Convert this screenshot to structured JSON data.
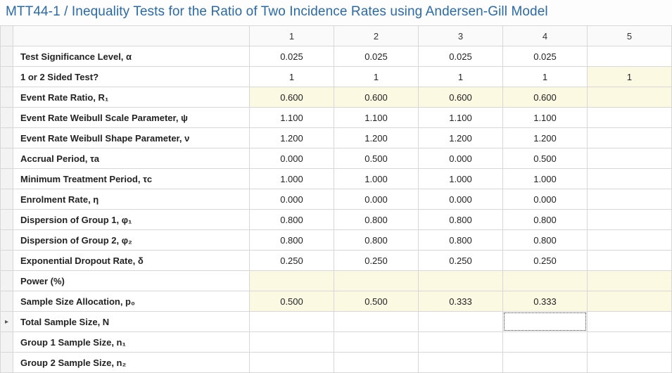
{
  "title": "MTT44-1 / Inequality Tests for the Ratio of Two Incidence Rates using Andersen-Gill Model",
  "columns": [
    "1",
    "2",
    "3",
    "4",
    "5"
  ],
  "rows": [
    {
      "label": "Test Significance Level, α",
      "values": [
        "0.025",
        "0.025",
        "0.025",
        "0.025",
        ""
      ],
      "hl": [
        false,
        false,
        false,
        false,
        false
      ]
    },
    {
      "label": "1 or 2 Sided Test?",
      "values": [
        "1",
        "1",
        "1",
        "1",
        "1"
      ],
      "hl": [
        false,
        false,
        false,
        false,
        true
      ]
    },
    {
      "label": "Event Rate Ratio, R₁",
      "values": [
        "0.600",
        "0.600",
        "0.600",
        "0.600",
        ""
      ],
      "hl": [
        true,
        true,
        true,
        true,
        true
      ]
    },
    {
      "label": "Event Rate Weibull Scale Parameter, ψ",
      "values": [
        "1.100",
        "1.100",
        "1.100",
        "1.100",
        ""
      ],
      "hl": [
        false,
        false,
        false,
        false,
        false
      ]
    },
    {
      "label": "Event Rate Weibull Shape Parameter, ν",
      "values": [
        "1.200",
        "1.200",
        "1.200",
        "1.200",
        ""
      ],
      "hl": [
        false,
        false,
        false,
        false,
        false
      ]
    },
    {
      "label": "Accrual Period, τa",
      "values": [
        "0.000",
        "0.500",
        "0.000",
        "0.500",
        ""
      ],
      "hl": [
        false,
        false,
        false,
        false,
        false
      ]
    },
    {
      "label": "Minimum Treatment Period, τc",
      "values": [
        "1.000",
        "1.000",
        "1.000",
        "1.000",
        ""
      ],
      "hl": [
        false,
        false,
        false,
        false,
        false
      ]
    },
    {
      "label": "Enrolment Rate, η",
      "values": [
        "0.000",
        "0.000",
        "0.000",
        "0.000",
        ""
      ],
      "hl": [
        false,
        false,
        false,
        false,
        false
      ]
    },
    {
      "label": "Dispersion of Group 1, φ₁",
      "values": [
        "0.800",
        "0.800",
        "0.800",
        "0.800",
        ""
      ],
      "hl": [
        false,
        false,
        false,
        false,
        false
      ]
    },
    {
      "label": "Dispersion of Group 2, φ₂",
      "values": [
        "0.800",
        "0.800",
        "0.800",
        "0.800",
        ""
      ],
      "hl": [
        false,
        false,
        false,
        false,
        false
      ]
    },
    {
      "label": "Exponential Dropout Rate, δ",
      "values": [
        "0.250",
        "0.250",
        "0.250",
        "0.250",
        ""
      ],
      "hl": [
        false,
        false,
        false,
        false,
        false
      ]
    },
    {
      "label": "Power (%)",
      "values": [
        "",
        "",
        "",
        "",
        ""
      ],
      "hl": [
        true,
        true,
        true,
        true,
        true
      ]
    },
    {
      "label": "Sample Size Allocation, p₀",
      "values": [
        "0.500",
        "0.500",
        "0.333",
        "0.333",
        ""
      ],
      "hl": [
        true,
        true,
        true,
        true,
        true
      ]
    },
    {
      "label": "Total Sample Size, N",
      "values": [
        "",
        "",
        "",
        "",
        ""
      ],
      "hl": [
        false,
        false,
        false,
        false,
        false
      ],
      "selectedCol": 3,
      "activeRow": true
    },
    {
      "label": "Group 1 Sample Size, n₁",
      "values": [
        "",
        "",
        "",
        "",
        ""
      ],
      "hl": [
        false,
        false,
        false,
        false,
        false
      ]
    },
    {
      "label": "Group 2 Sample Size, n₂",
      "values": [
        "",
        "",
        "",
        "",
        ""
      ],
      "hl": [
        false,
        false,
        false,
        false,
        false
      ]
    }
  ],
  "rowIndicator": "▸"
}
